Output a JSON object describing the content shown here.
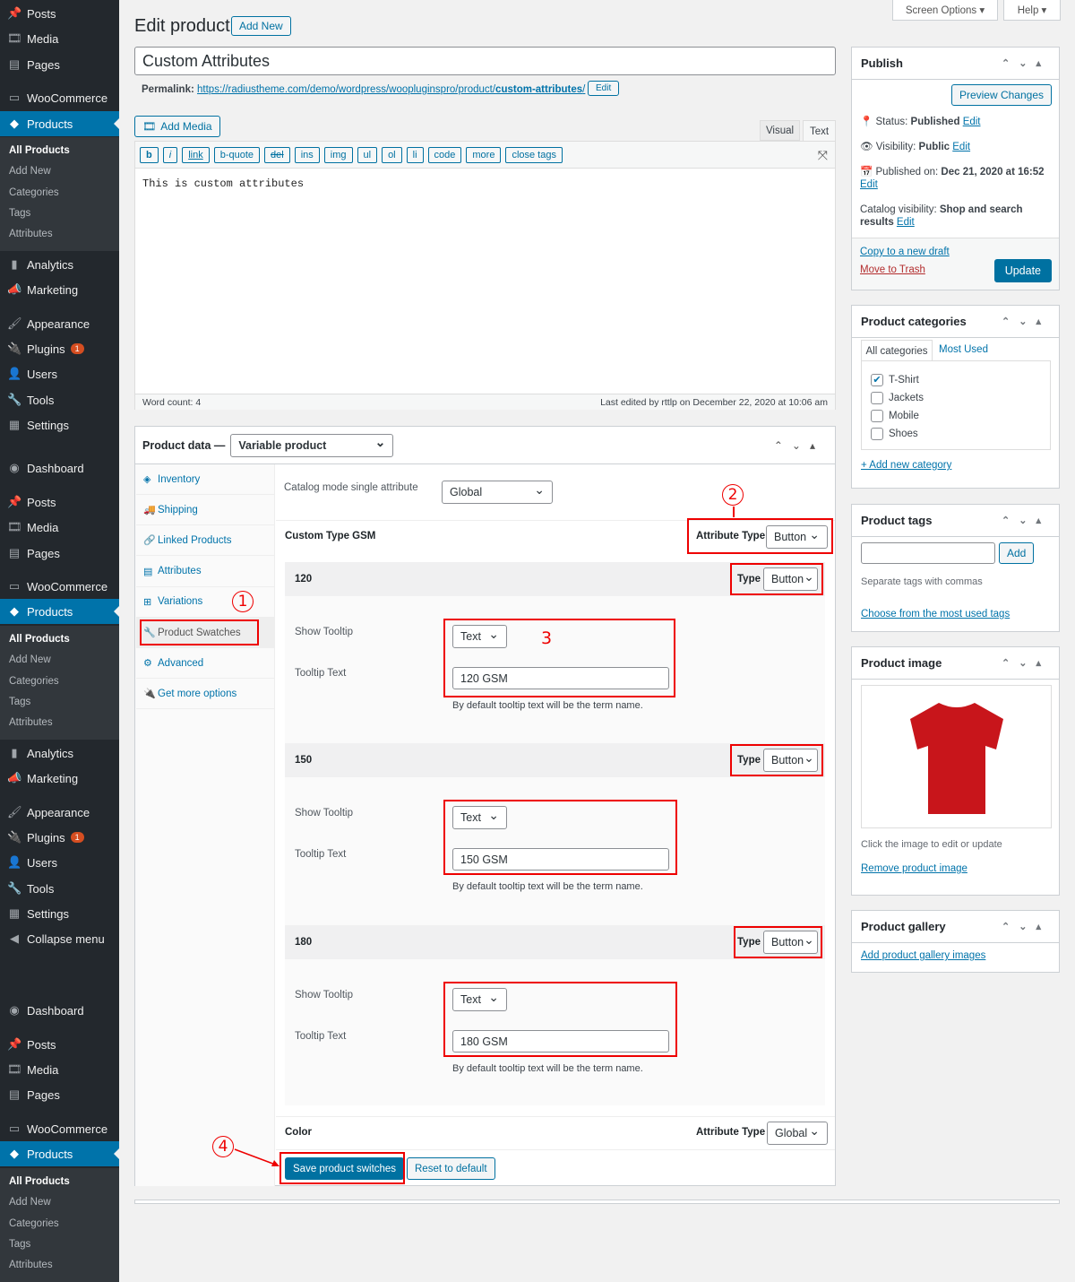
{
  "sidebar": {
    "items": [
      {
        "label": "Posts",
        "icon": "pin-icon"
      },
      {
        "label": "Media",
        "icon": "media-icon"
      },
      {
        "label": "Pages",
        "icon": "pages-icon"
      },
      {
        "label": "WooCommerce",
        "icon": "woo-icon"
      },
      {
        "label": "Products",
        "icon": "box-icon",
        "active": true
      },
      {
        "label": "Analytics",
        "icon": "chart-icon"
      },
      {
        "label": "Marketing",
        "icon": "megaphone-icon"
      },
      {
        "label": "Appearance",
        "icon": "brush-icon"
      },
      {
        "label": "Plugins",
        "icon": "plug-icon",
        "badge": "1"
      },
      {
        "label": "Users",
        "icon": "user-icon"
      },
      {
        "label": "Tools",
        "icon": "wrench-icon"
      },
      {
        "label": "Settings",
        "icon": "settings-icon"
      },
      {
        "label": "Collapse menu",
        "icon": "collapse-icon"
      },
      {
        "label": "Dashboard",
        "icon": "dashboard-icon"
      }
    ],
    "submenu": [
      "All Products",
      "Add New",
      "Categories",
      "Tags",
      "Attributes"
    ]
  },
  "header": {
    "title": "Edit product",
    "add_new": "Add New",
    "screen_options": "Screen Options ▾",
    "help": "Help ▾"
  },
  "post": {
    "title": "Custom Attributes",
    "permalink_label": "Permalink:",
    "permalink_base": "https://radiustheme.com/demo/wordpress/woopluginspro/product/",
    "permalink_slug": "custom-attributes",
    "permalink_end": "/",
    "edit": "Edit"
  },
  "editor": {
    "add_media": "Add Media",
    "tab_visual": "Visual",
    "tab_text": "Text",
    "quicktags": [
      "b",
      "i",
      "link",
      "b-quote",
      "del",
      "ins",
      "img",
      "ul",
      "ol",
      "li",
      "code",
      "more",
      "close tags"
    ],
    "content": "This is custom attributes",
    "word_count": "Word count: 4",
    "last_edited": "Last edited by rttlp on December 22, 2020 at 10:06 am"
  },
  "product_data": {
    "label": "Product data —",
    "type": "Variable product",
    "tabs": [
      {
        "label": "Inventory",
        "icon": "inventory-icon"
      },
      {
        "label": "Shipping",
        "icon": "truck-icon"
      },
      {
        "label": "Linked Products",
        "icon": "link-icon"
      },
      {
        "label": "Attributes",
        "icon": "attributes-icon"
      },
      {
        "label": "Variations",
        "icon": "grid-icon"
      },
      {
        "label": "Product Swatches",
        "icon": "wrench-icon"
      },
      {
        "label": "Advanced",
        "icon": "gear-icon"
      },
      {
        "label": "Get more options",
        "icon": "plug-icon"
      }
    ],
    "catalog_label": "Catalog mode single attribute",
    "catalog_value": "Global",
    "attribute_name": "Custom Type GSM",
    "attribute_type_label": "Attribute Type",
    "attribute_type": "Button",
    "terms": [
      {
        "name": "120",
        "type_label": "Type",
        "type": "Button",
        "show_tooltip_label": "Show Tooltip",
        "show_tooltip": "Text",
        "tooltip_text_label": "Tooltip Text",
        "tooltip_text": "120 GSM",
        "help": "By default tooltip text will be the term name."
      },
      {
        "name": "150",
        "type_label": "Type",
        "type": "Button",
        "show_tooltip_label": "Show Tooltip",
        "show_tooltip": "Text",
        "tooltip_text_label": "Tooltip Text",
        "tooltip_text": "150 GSM",
        "help": "By default tooltip text will be the term name."
      },
      {
        "name": "180",
        "type_label": "Type",
        "type": "Button",
        "show_tooltip_label": "Show Tooltip",
        "show_tooltip": "Text",
        "tooltip_text_label": "Tooltip Text",
        "tooltip_text": "180 GSM",
        "help": "By default tooltip text will be the term name."
      }
    ],
    "color_name": "Color",
    "color_type_label": "Attribute Type",
    "color_type": "Global",
    "save": "Save product switches",
    "reset": "Reset to default"
  },
  "annotations": [
    "1",
    "2",
    "3",
    "4"
  ],
  "publish": {
    "title": "Publish",
    "preview": "Preview Changes",
    "status_label": "Status:",
    "status": "Published",
    "visibility_label": "Visibility:",
    "visibility": "Public",
    "published_label": "Published on:",
    "published": "Dec 21, 2020 at 16:52",
    "catalog_label": "Catalog visibility:",
    "catalog": "Shop and search results",
    "edit": "Edit",
    "copy": "Copy to a new draft",
    "trash": "Move to Trash",
    "update": "Update"
  },
  "categories": {
    "title": "Product categories",
    "tab_all": "All categories",
    "tab_used": "Most Used",
    "items": [
      {
        "label": "T-Shirt",
        "checked": true
      },
      {
        "label": "Jackets",
        "checked": false
      },
      {
        "label": "Mobile",
        "checked": false
      },
      {
        "label": "Shoes",
        "checked": false
      }
    ],
    "add": "+ Add new category"
  },
  "tags": {
    "title": "Product tags",
    "add": "Add",
    "hint": "Separate tags with commas",
    "choose": "Choose from the most used tags"
  },
  "image": {
    "title": "Product image",
    "hint": "Click the image to edit or update",
    "remove": "Remove product image",
    "shirt_color": "#c8151b"
  },
  "gallery": {
    "title": "Product gallery",
    "add": "Add product gallery images"
  },
  "colors": {
    "accent": "#0073aa",
    "sidebar": "#23282d",
    "annotation": "#e00000"
  }
}
